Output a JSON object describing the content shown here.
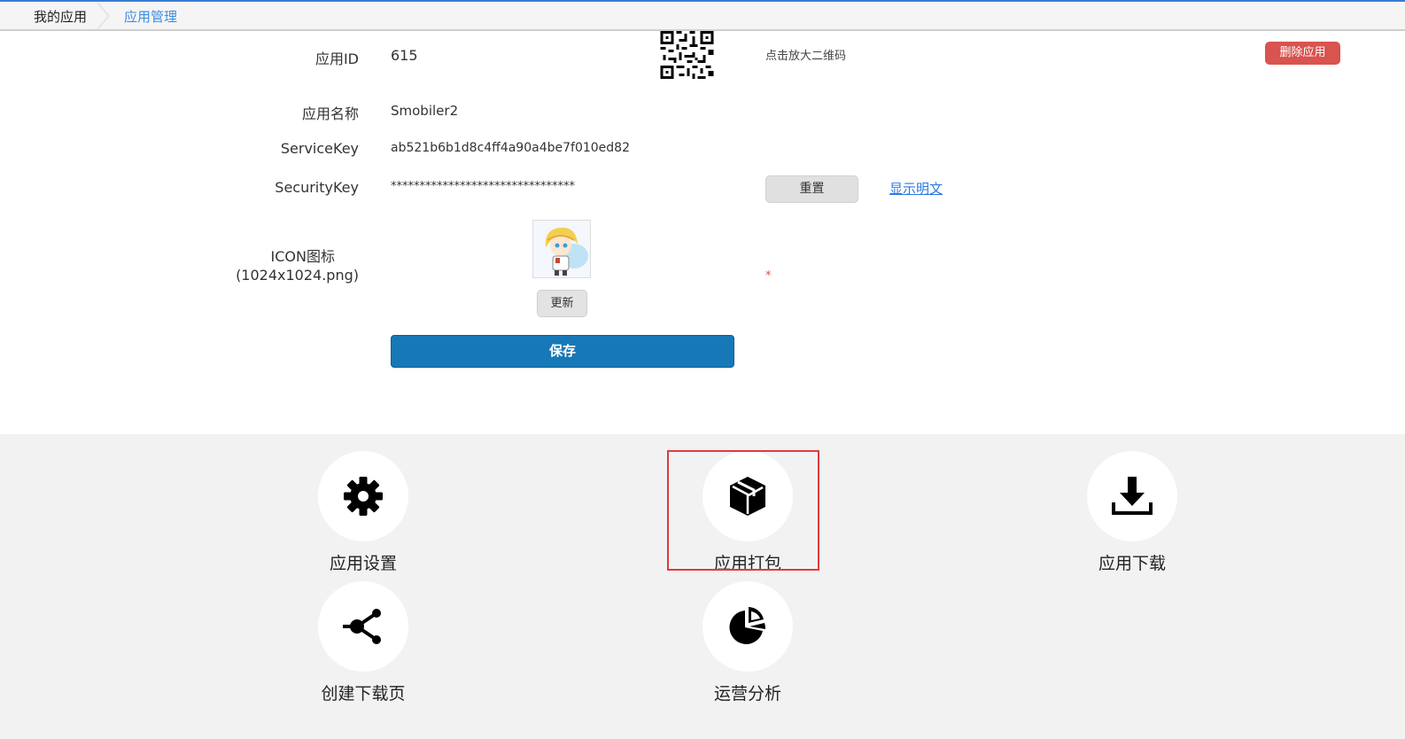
{
  "breadcrumb": {
    "home": "我的应用",
    "current": "应用管理"
  },
  "form": {
    "app_id_label": "应用ID",
    "app_id_value": "615",
    "qr_hint": "点击放大二维码",
    "delete_label": "删除应用",
    "app_name_label": "应用名称",
    "app_name_value": "Smobiler2",
    "service_key_label": "ServiceKey",
    "service_key_value": "ab521b6b1d8c4ff4a90a4be7f010ed82",
    "security_key_label": "SecurityKey",
    "security_key_value": "********************************",
    "reset_label": "重置",
    "show_plain_label": "显示明文",
    "icon_label_line1": "ICON图标",
    "icon_label_line2": "(1024x1024.png)",
    "update_label": "更新",
    "required_mark": "*",
    "save_label": "保存"
  },
  "tiles": [
    {
      "label": "应用设置",
      "icon": "gear-icon"
    },
    {
      "label": "应用打包",
      "icon": "package-icon",
      "highlighted": true
    },
    {
      "label": "应用下载",
      "icon": "download-icon"
    },
    {
      "label": "创建下载页",
      "icon": "share-icon"
    },
    {
      "label": "运营分析",
      "icon": "pie-chart-icon"
    }
  ],
  "colors": {
    "accent": "#1778b7",
    "danger": "#d9534f",
    "link": "#2a7ae2",
    "highlight_border": "#e03b3b"
  }
}
